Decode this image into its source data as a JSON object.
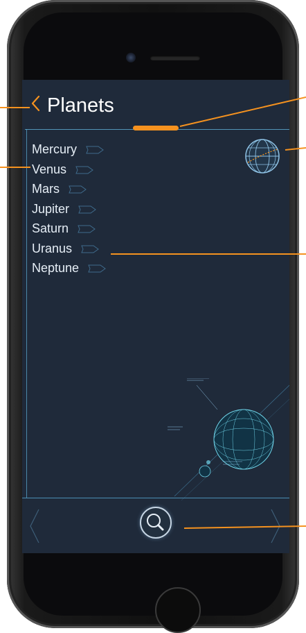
{
  "app": {
    "title": "Planets",
    "back_label": "Planets"
  },
  "planets": [
    {
      "label": "Mercury"
    },
    {
      "label": "Venus"
    },
    {
      "label": "Mars"
    },
    {
      "label": "Jupiter"
    },
    {
      "label": "Saturn"
    },
    {
      "label": "Uranus"
    },
    {
      "label": "Neptune"
    }
  ],
  "colors": {
    "accent": "#f5921f",
    "screen_background": "#1f2a3a",
    "line_blue": "#5fb0d8",
    "text": "#e6eef6"
  },
  "icons": {
    "back": "chevron-left-icon",
    "globe": "globe-grid-icon",
    "search": "magnifier-icon",
    "list_arrow": "outline-arrow-icon",
    "prev": "chevron-left-icon",
    "next": "chevron-right-icon"
  }
}
